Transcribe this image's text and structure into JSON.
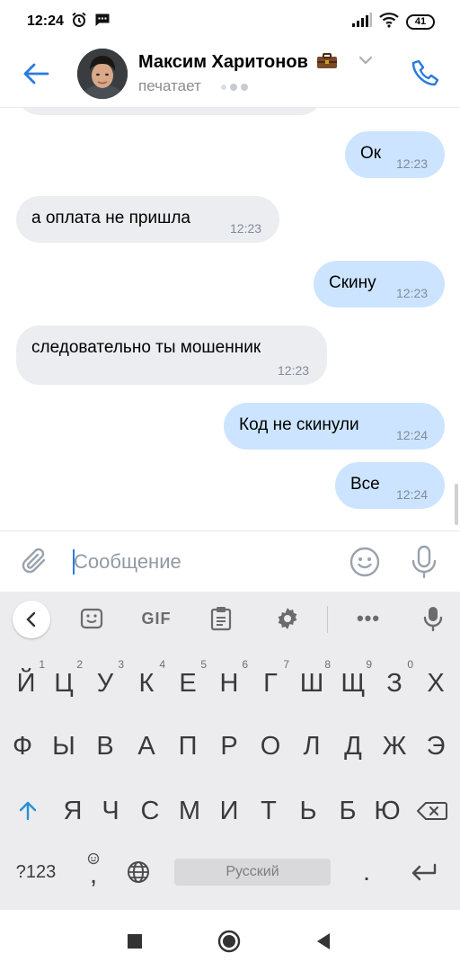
{
  "status_bar": {
    "time": "12:24",
    "battery": "41"
  },
  "header": {
    "contact_name": "Максим Харитонов",
    "status": "печатает"
  },
  "messages": [
    {
      "direction": "out",
      "text": "Ок",
      "time": "12:23"
    },
    {
      "direction": "in",
      "text": "а оплата не пришла",
      "time": "12:23"
    },
    {
      "direction": "out",
      "text": "Скину",
      "time": "12:23"
    },
    {
      "direction": "in",
      "text": "следовательно ты мошенник",
      "time": "12:23"
    },
    {
      "direction": "out",
      "text": "Код не скинули",
      "time": "12:24"
    },
    {
      "direction": "out",
      "text": "Все",
      "time": "12:24"
    }
  ],
  "composer": {
    "placeholder": "Сообщение",
    "value": ""
  },
  "keyboard": {
    "toolbar": {
      "gif_label": "GIF",
      "more_label": "•••"
    },
    "row1": [
      {
        "label": "Й",
        "hint": "1"
      },
      {
        "label": "Ц",
        "hint": "2"
      },
      {
        "label": "У",
        "hint": "3"
      },
      {
        "label": "К",
        "hint": "4"
      },
      {
        "label": "Е",
        "hint": "5"
      },
      {
        "label": "Н",
        "hint": "6"
      },
      {
        "label": "Г",
        "hint": "7"
      },
      {
        "label": "Ш",
        "hint": "8"
      },
      {
        "label": "Щ",
        "hint": "9"
      },
      {
        "label": "З",
        "hint": "0"
      },
      {
        "label": "Х",
        "hint": ""
      }
    ],
    "row2": [
      "Ф",
      "Ы",
      "В",
      "А",
      "П",
      "Р",
      "О",
      "Л",
      "Д",
      "Ж",
      "Э"
    ],
    "row3": [
      "Я",
      "Ч",
      "С",
      "М",
      "И",
      "Т",
      "Ь",
      "Б",
      "Ю"
    ],
    "symbols_label": "?123",
    "comma_label": ",",
    "space_label": "Русский",
    "period_label": "."
  },
  "colors": {
    "accent": "#2a7ade",
    "incoming_bubble": "#ebedf0",
    "outgoing_bubble": "#cce4ff",
    "timestamp": "#818c99",
    "keyboard_bg": "#ececee"
  }
}
